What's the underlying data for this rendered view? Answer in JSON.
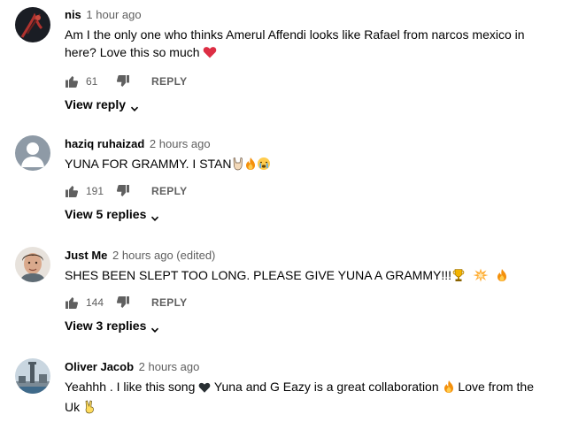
{
  "comments": [
    {
      "author": "nis",
      "time": "1 hour ago",
      "text": "Am I the only one who thinks Amerul Affendi looks like Rafael from narcos mexico in here? Love this so much",
      "emojis": [
        "red-heart"
      ],
      "likes": "61",
      "reply_label": "REPLY",
      "view_replies": "View reply"
    },
    {
      "author": "haziq ruhaizad",
      "time": "2 hours ago",
      "text": "YUNA FOR GRAMMY. I STAN",
      "emojis": [
        "sign-of-horns",
        "fire",
        "crying-face"
      ],
      "likes": "191",
      "reply_label": "REPLY",
      "view_replies": "View 5 replies"
    },
    {
      "author": "Just Me",
      "time": "2 hours ago (edited)",
      "text": "SHES BEEN SLEPT TOO LONG. PLEASE GIVE YUNA A GRAMMY!!!",
      "emojis": [
        "trophy",
        "collision",
        "fire"
      ],
      "likes": "144",
      "reply_label": "REPLY",
      "view_replies": "View 3 replies"
    },
    {
      "author": "Oliver Jacob",
      "time": "2 hours ago",
      "text_parts": [
        "Yeahhh . I like this song",
        "Yuna and G Eazy is a great collaboration",
        "Love from the Uk"
      ],
      "emojis": [
        "black-heart",
        "fire",
        "victory-hand"
      ]
    }
  ],
  "colors": {
    "text_primary": "#030303",
    "text_secondary": "#606060",
    "background": "#ffffff"
  }
}
